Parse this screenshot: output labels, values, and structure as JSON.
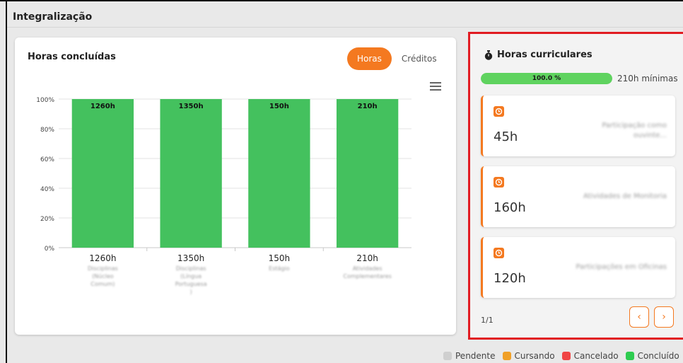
{
  "page": {
    "title": "Integralização"
  },
  "chart_card": {
    "title": "Horas concluídas",
    "toggle": [
      {
        "label": "Horas",
        "active": true
      },
      {
        "label": "Créditos",
        "active": false
      }
    ],
    "menu_icon": "hamburger-menu-icon"
  },
  "chart_data": {
    "type": "bar",
    "categories": [
      "1260h",
      "1350h",
      "150h",
      "210h"
    ],
    "category_sublabels": [
      [
        "Disciplinas",
        "(Núcleo",
        "Comum)"
      ],
      [
        "Disciplinas",
        "(Língua",
        "Portuguesa",
        ")"
      ],
      [
        "Estágio"
      ],
      [
        "Atividades",
        "Complementares"
      ]
    ],
    "values": [
      100,
      100,
      100,
      100
    ],
    "data_labels": [
      "1260h",
      "1350h",
      "150h",
      "210h"
    ],
    "ylim": [
      0,
      100
    ],
    "y_ticks": [
      "0%",
      "20%",
      "40%",
      "60%",
      "80%",
      "100%"
    ],
    "grid": true,
    "color": "#44c15e"
  },
  "curricular": {
    "title": "Horas curriculares",
    "icon": "stopwatch-icon",
    "progress_percent": 100,
    "progress_label": "100.0 %",
    "progress_note": "210h mínimas",
    "activities": [
      {
        "hours": "45h",
        "label": "Participação como ouvinte..."
      },
      {
        "hours": "160h",
        "label": "Atividades de Monitoria"
      },
      {
        "hours": "120h",
        "label": "Participações em Oficinas"
      }
    ],
    "pagination": "1/1",
    "prev_label": "‹",
    "next_label": "›"
  },
  "legend": [
    {
      "label": "Pendente",
      "color": "#cfcfcf"
    },
    {
      "label": "Cursando",
      "color": "#f0a028"
    },
    {
      "label": "Cancelado",
      "color": "#f04545"
    },
    {
      "label": "Concluído",
      "color": "#2ecc50"
    }
  ],
  "colors": {
    "accent": "#f47920",
    "highlight_border": "#e11b22"
  }
}
